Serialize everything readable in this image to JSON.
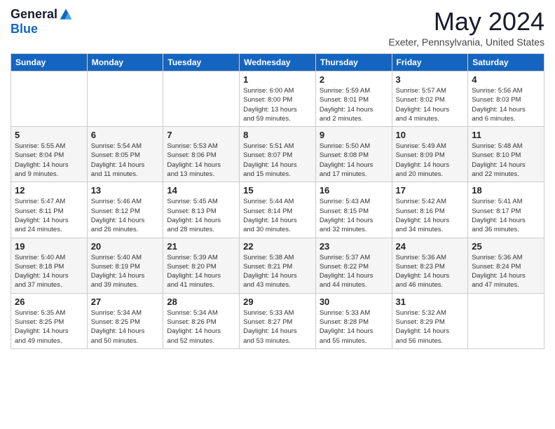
{
  "header": {
    "logo_general": "General",
    "logo_blue": "Blue",
    "month_title": "May 2024",
    "subtitle": "Exeter, Pennsylvania, United States"
  },
  "days_of_week": [
    "Sunday",
    "Monday",
    "Tuesday",
    "Wednesday",
    "Thursday",
    "Friday",
    "Saturday"
  ],
  "weeks": [
    [
      {
        "day": "",
        "detail": ""
      },
      {
        "day": "",
        "detail": ""
      },
      {
        "day": "",
        "detail": ""
      },
      {
        "day": "1",
        "detail": "Sunrise: 6:00 AM\nSunset: 8:00 PM\nDaylight: 13 hours\nand 59 minutes."
      },
      {
        "day": "2",
        "detail": "Sunrise: 5:59 AM\nSunset: 8:01 PM\nDaylight: 14 hours\nand 2 minutes."
      },
      {
        "day": "3",
        "detail": "Sunrise: 5:57 AM\nSunset: 8:02 PM\nDaylight: 14 hours\nand 4 minutes."
      },
      {
        "day": "4",
        "detail": "Sunrise: 5:56 AM\nSunset: 8:03 PM\nDaylight: 14 hours\nand 6 minutes."
      }
    ],
    [
      {
        "day": "5",
        "detail": "Sunrise: 5:55 AM\nSunset: 8:04 PM\nDaylight: 14 hours\nand 9 minutes."
      },
      {
        "day": "6",
        "detail": "Sunrise: 5:54 AM\nSunset: 8:05 PM\nDaylight: 14 hours\nand 11 minutes."
      },
      {
        "day": "7",
        "detail": "Sunrise: 5:53 AM\nSunset: 8:06 PM\nDaylight: 14 hours\nand 13 minutes."
      },
      {
        "day": "8",
        "detail": "Sunrise: 5:51 AM\nSunset: 8:07 PM\nDaylight: 14 hours\nand 15 minutes."
      },
      {
        "day": "9",
        "detail": "Sunrise: 5:50 AM\nSunset: 8:08 PM\nDaylight: 14 hours\nand 17 minutes."
      },
      {
        "day": "10",
        "detail": "Sunrise: 5:49 AM\nSunset: 8:09 PM\nDaylight: 14 hours\nand 20 minutes."
      },
      {
        "day": "11",
        "detail": "Sunrise: 5:48 AM\nSunset: 8:10 PM\nDaylight: 14 hours\nand 22 minutes."
      }
    ],
    [
      {
        "day": "12",
        "detail": "Sunrise: 5:47 AM\nSunset: 8:11 PM\nDaylight: 14 hours\nand 24 minutes."
      },
      {
        "day": "13",
        "detail": "Sunrise: 5:46 AM\nSunset: 8:12 PM\nDaylight: 14 hours\nand 26 minutes."
      },
      {
        "day": "14",
        "detail": "Sunrise: 5:45 AM\nSunset: 8:13 PM\nDaylight: 14 hours\nand 28 minutes."
      },
      {
        "day": "15",
        "detail": "Sunrise: 5:44 AM\nSunset: 8:14 PM\nDaylight: 14 hours\nand 30 minutes."
      },
      {
        "day": "16",
        "detail": "Sunrise: 5:43 AM\nSunset: 8:15 PM\nDaylight: 14 hours\nand 32 minutes."
      },
      {
        "day": "17",
        "detail": "Sunrise: 5:42 AM\nSunset: 8:16 PM\nDaylight: 14 hours\nand 34 minutes."
      },
      {
        "day": "18",
        "detail": "Sunrise: 5:41 AM\nSunset: 8:17 PM\nDaylight: 14 hours\nand 36 minutes."
      }
    ],
    [
      {
        "day": "19",
        "detail": "Sunrise: 5:40 AM\nSunset: 8:18 PM\nDaylight: 14 hours\nand 37 minutes."
      },
      {
        "day": "20",
        "detail": "Sunrise: 5:40 AM\nSunset: 8:19 PM\nDaylight: 14 hours\nand 39 minutes."
      },
      {
        "day": "21",
        "detail": "Sunrise: 5:39 AM\nSunset: 8:20 PM\nDaylight: 14 hours\nand 41 minutes."
      },
      {
        "day": "22",
        "detail": "Sunrise: 5:38 AM\nSunset: 8:21 PM\nDaylight: 14 hours\nand 43 minutes."
      },
      {
        "day": "23",
        "detail": "Sunrise: 5:37 AM\nSunset: 8:22 PM\nDaylight: 14 hours\nand 44 minutes."
      },
      {
        "day": "24",
        "detail": "Sunrise: 5:36 AM\nSunset: 8:23 PM\nDaylight: 14 hours\nand 46 minutes."
      },
      {
        "day": "25",
        "detail": "Sunrise: 5:36 AM\nSunset: 8:24 PM\nDaylight: 14 hours\nand 47 minutes."
      }
    ],
    [
      {
        "day": "26",
        "detail": "Sunrise: 5:35 AM\nSunset: 8:25 PM\nDaylight: 14 hours\nand 49 minutes."
      },
      {
        "day": "27",
        "detail": "Sunrise: 5:34 AM\nSunset: 8:25 PM\nDaylight: 14 hours\nand 50 minutes."
      },
      {
        "day": "28",
        "detail": "Sunrise: 5:34 AM\nSunset: 8:26 PM\nDaylight: 14 hours\nand 52 minutes."
      },
      {
        "day": "29",
        "detail": "Sunrise: 5:33 AM\nSunset: 8:27 PM\nDaylight: 14 hours\nand 53 minutes."
      },
      {
        "day": "30",
        "detail": "Sunrise: 5:33 AM\nSunset: 8:28 PM\nDaylight: 14 hours\nand 55 minutes."
      },
      {
        "day": "31",
        "detail": "Sunrise: 5:32 AM\nSunset: 8:29 PM\nDaylight: 14 hours\nand 56 minutes."
      },
      {
        "day": "",
        "detail": ""
      }
    ]
  ]
}
